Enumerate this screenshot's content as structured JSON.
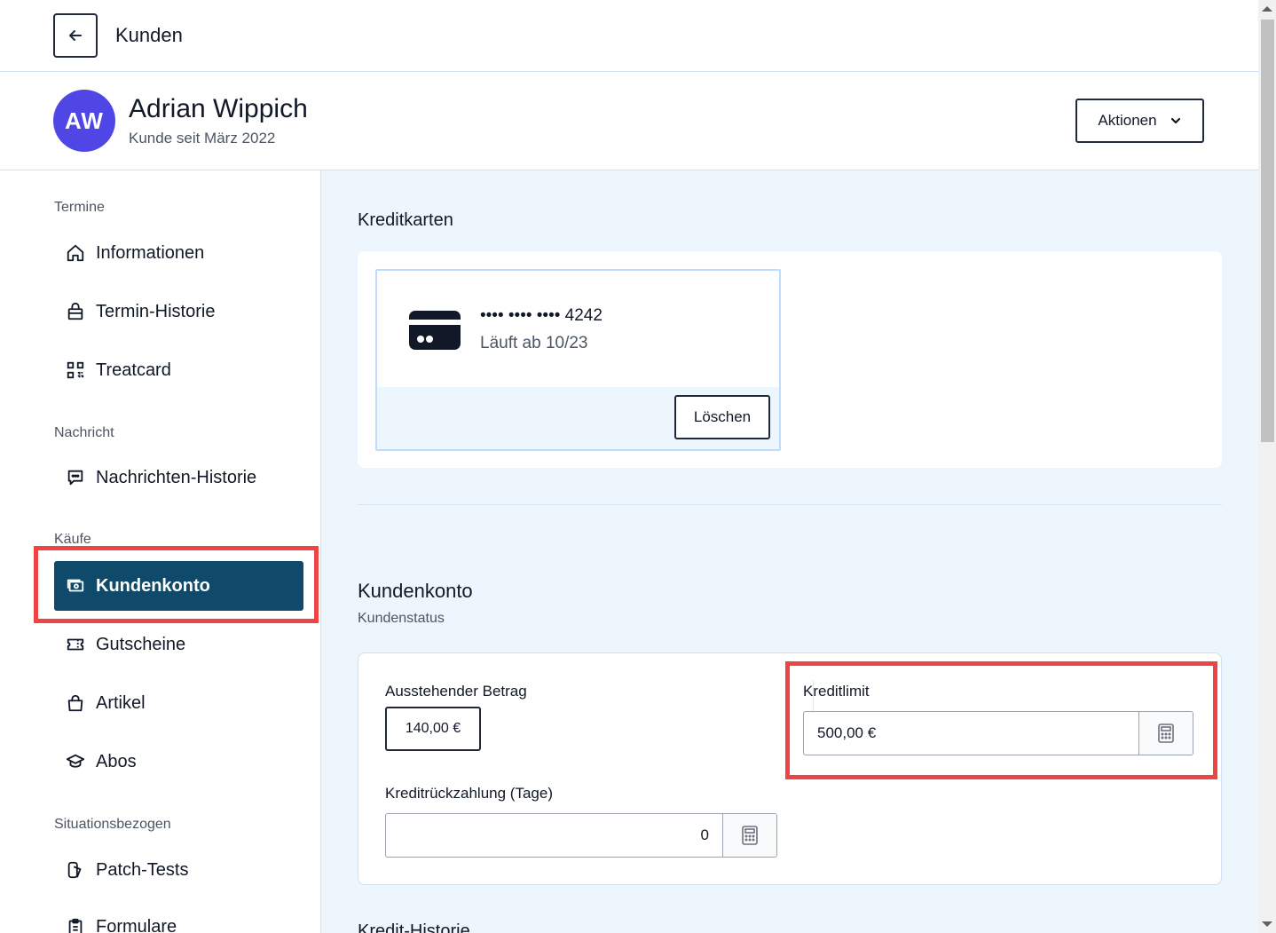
{
  "topbar": {
    "title": "Kunden"
  },
  "customer": {
    "initials": "AW",
    "name": "Adrian Wippich",
    "since": "Kunde seit März 2022"
  },
  "header": {
    "actions_label": "Aktionen"
  },
  "sidebar": {
    "sections": [
      "Termine",
      "Nachricht",
      "Käufe",
      "Situationsbezogen"
    ],
    "items": [
      {
        "label": "Informationen",
        "icon": "home-icon"
      },
      {
        "label": "Termin-Historie",
        "icon": "bag-icon"
      },
      {
        "label": "Treatcard",
        "icon": "qr-code-icon"
      },
      {
        "label": "Nachrichten-Historie",
        "icon": "chat-bubble-icon"
      },
      {
        "label": "Kundenkonto",
        "icon": "cash-icon",
        "active": true
      },
      {
        "label": "Gutscheine",
        "icon": "ticket-icon"
      },
      {
        "label": "Artikel",
        "icon": "shopping-bag-icon"
      },
      {
        "label": "Abos",
        "icon": "academic-cap-icon"
      },
      {
        "label": "Patch-Tests",
        "icon": "patch-icon"
      },
      {
        "label": "Formulare",
        "icon": "clipboard-icon"
      }
    ]
  },
  "main": {
    "credit_cards": {
      "title": "Kreditkarten",
      "card_number": "•••• •••• •••• 4242",
      "expiry": "Läuft ab 10/23",
      "delete_label": "Löschen"
    },
    "account": {
      "title": "Kundenkonto",
      "subtitle": "Kundenstatus",
      "outstanding_label": "Ausstehender Betrag",
      "outstanding_value": "140,00 €",
      "credit_limit_label": "Kreditlimit",
      "credit_limit_value": "500,00 €",
      "repayment_label": "Kreditrückzahlung (Tage)",
      "repayment_value": "0"
    },
    "next_section_title": "Kredit-Historie"
  },
  "colors": {
    "accent": "#0f4a6b",
    "avatar": "#4f46e5",
    "highlight": "#ef4444",
    "main_bg": "#eef6fd"
  }
}
